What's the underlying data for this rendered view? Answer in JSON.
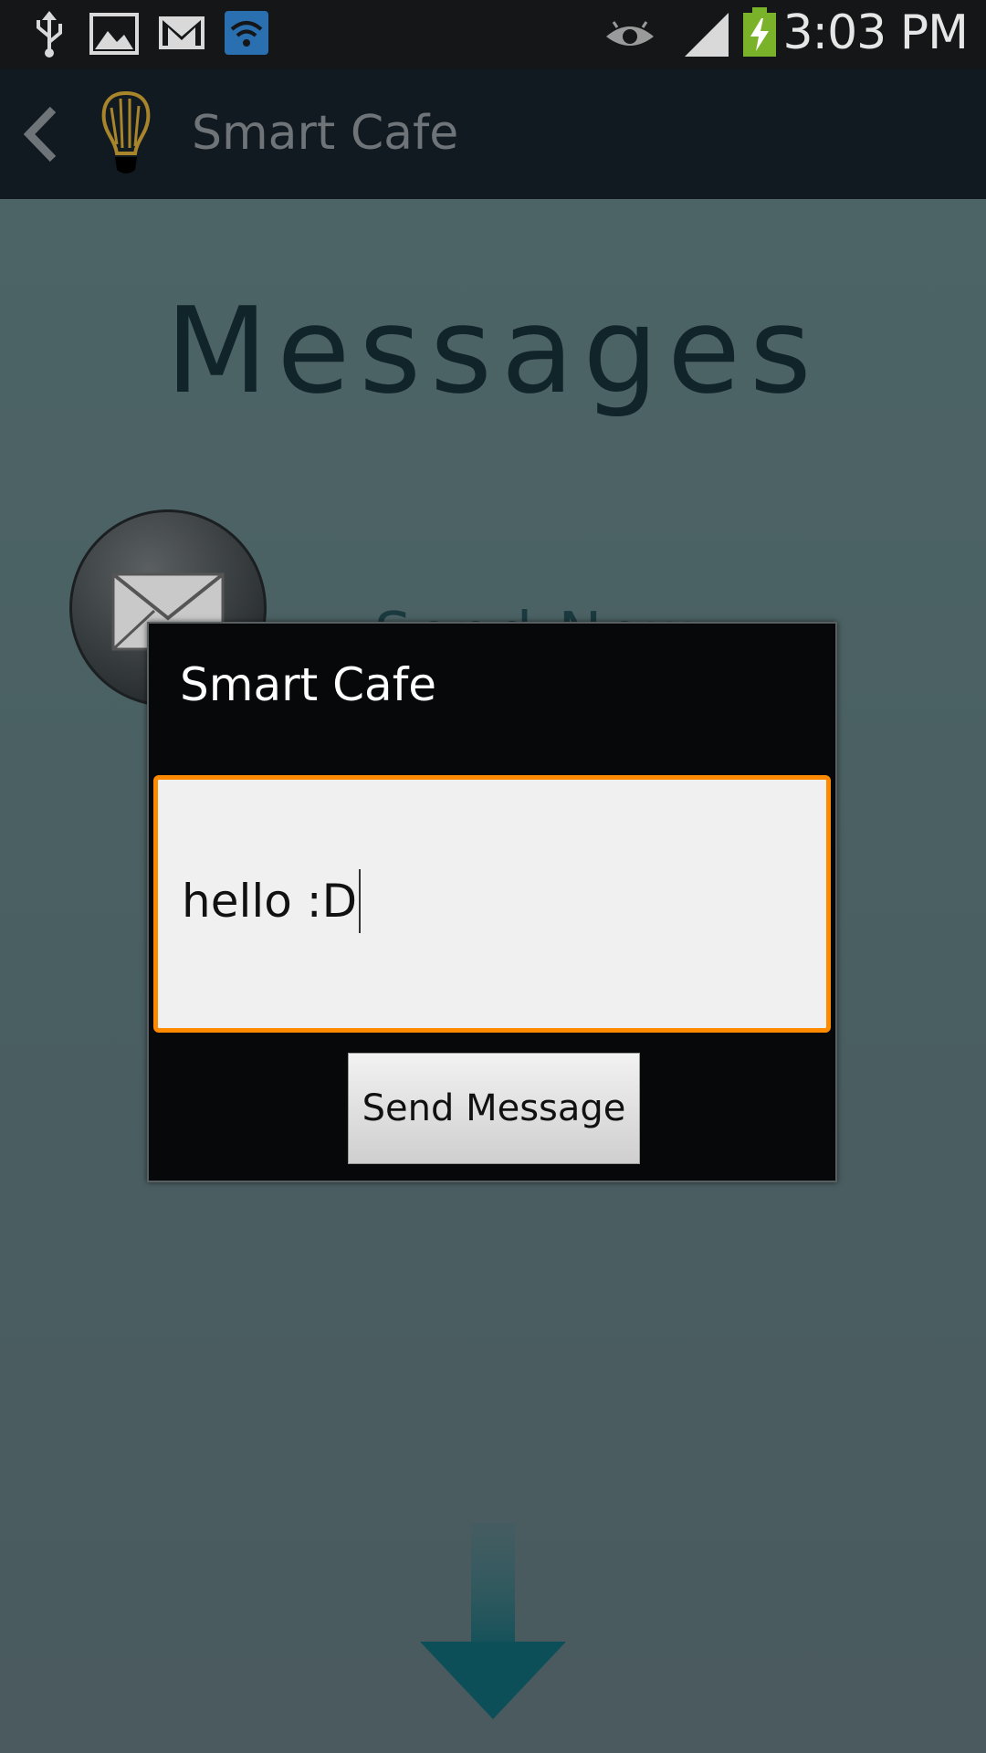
{
  "status_bar": {
    "time": "3:03 PM",
    "icons": [
      "usb-icon",
      "gallery-icon",
      "gmail-icon",
      "wifi-app-icon",
      "eye-icon",
      "signal-icon",
      "battery-charging-icon"
    ]
  },
  "action_bar": {
    "title": "Smart Cafe"
  },
  "content": {
    "heading": "Messages",
    "send_new_label": "Send New Message"
  },
  "dialog": {
    "title": "Smart Cafe",
    "input_value": "hello :D",
    "send_button_label": "Send Message"
  },
  "colors": {
    "accent_focus": "#ff8a00",
    "action_bar_bg": "#121a21",
    "content_bg": "#4d6466"
  }
}
